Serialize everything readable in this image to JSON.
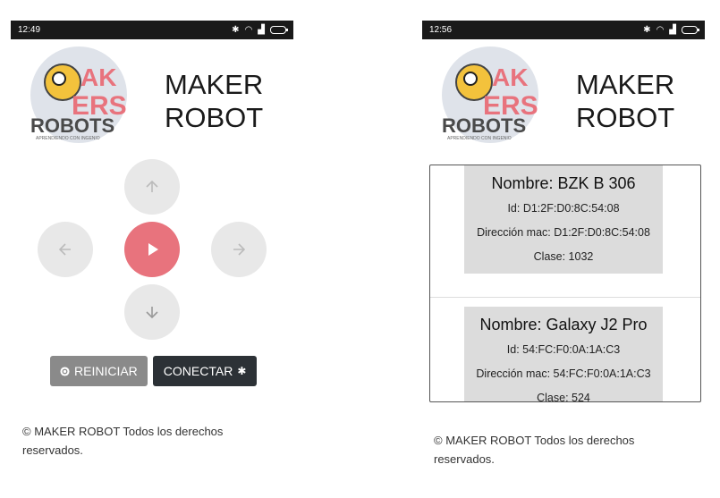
{
  "left": {
    "status_time": "12:49",
    "app_title": "MAKER ROBOT",
    "logo_text": "MAKERS ROBOTS",
    "logo_tagline": "APRENDIENDO CON INGENIO",
    "buttons": {
      "reset": "REINICIAR",
      "connect": "CONECTAR"
    },
    "footer": "© MAKER ROBOT Todos los derechos reservados."
  },
  "right": {
    "status_time": "12:56",
    "app_title": "MAKER ROBOT",
    "logo_text": "MAKERS ROBOTS",
    "logo_tagline": "APRENDIENDO CON INGENIO",
    "devices": [
      {
        "name": "Nombre: BZK B 306",
        "id": "Id: D1:2F:D0:8C:54:08",
        "mac": "Dirección mac: D1:2F:D0:8C:54:08",
        "clase": "Clase: 1032"
      },
      {
        "name": "Nombre: Galaxy J2 Pro",
        "id": "Id: 54:FC:F0:0A:1A:C3",
        "mac": "Dirección mac: 54:FC:F0:0A:1A:C3",
        "clase": "Clase: 524"
      }
    ],
    "footer": "© MAKER ROBOT Todos los derechos reservados."
  },
  "colors": {
    "play": "#e8737d",
    "dpad": "#e8e8e8",
    "reset": "#8a8a8a",
    "connect": "#2c3136",
    "statusbar": "#1a1a1a"
  },
  "icons": [
    "up-arrow-icon",
    "down-arrow-icon",
    "left-arrow-icon",
    "right-arrow-icon",
    "play-icon",
    "reset-icon",
    "bluetooth-icon",
    "wifi-icon",
    "signal-icon",
    "battery-icon"
  ]
}
